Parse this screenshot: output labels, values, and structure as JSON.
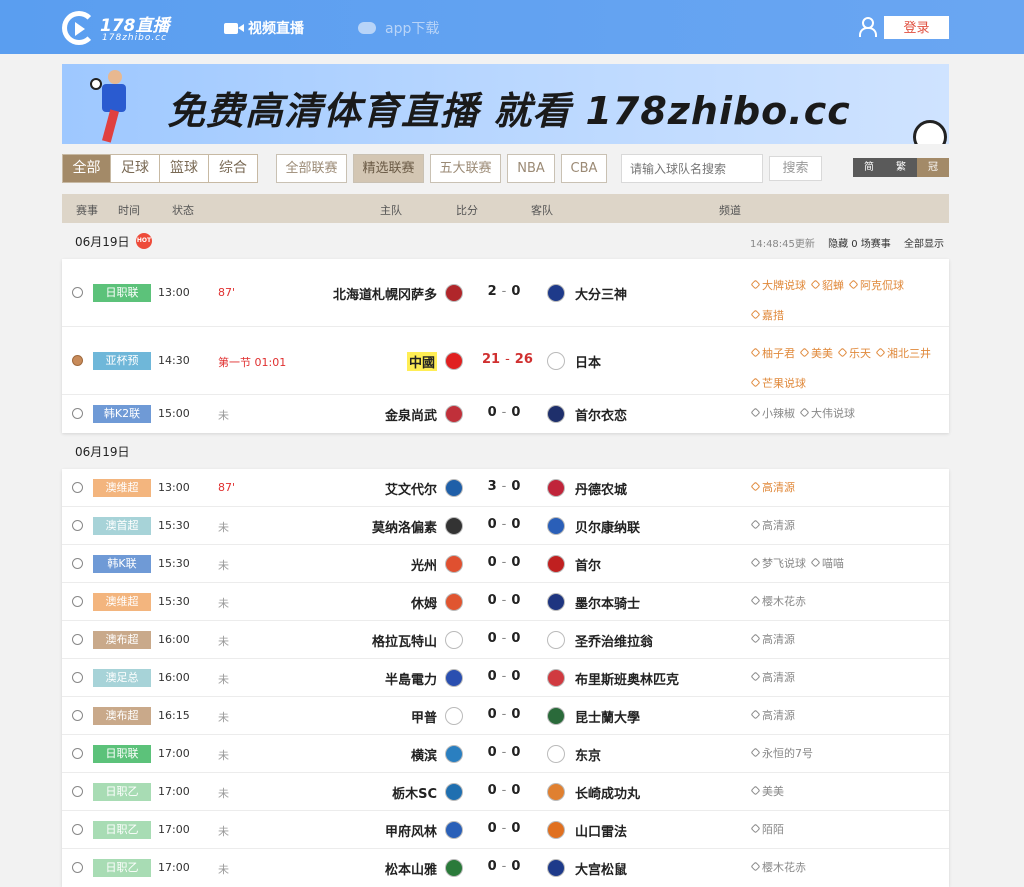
{
  "header": {
    "logo_name": "178直播",
    "logo_url": "178zhibo.cc",
    "nav_video": "视频直播",
    "nav_app": "app下载",
    "login": "登录"
  },
  "banner": {
    "text": "免费高清体育直播 就看 178zhibo.cc"
  },
  "filters": {
    "sports": [
      "全部",
      "足球",
      "篮球",
      "综合"
    ],
    "leagues": [
      "全部联赛",
      "精选联赛",
      "五大联赛",
      "NBA",
      "CBA"
    ],
    "search_placeholder": "请输入球队名搜索",
    "search_button": "搜索",
    "lang": [
      "简",
      "繁",
      "冠"
    ]
  },
  "table_header": [
    "赛事",
    "时间",
    "状态",
    "主队",
    "比分",
    "客队",
    "频道"
  ],
  "colors": {
    "league_green": "#5cc27a",
    "league_blue": "#6f9ad6",
    "league_orange": "#f3b57e",
    "league_cyan": "#a7d3d8",
    "league_khaki": "#c9a98a",
    "league_peach": "#e8b49a",
    "live_red": "#e03030",
    "accent_brown": "#a38a68"
  },
  "section1": {
    "date": "06月19日",
    "hot_label": "HOT",
    "update_time": "14:48:45更新",
    "hidden": "隐藏 0 场赛事",
    "show_all": "全部显示",
    "matches": [
      {
        "sport": "soccer",
        "league": "日职联",
        "lc": "#5cc27a",
        "time": "13:00",
        "status": "87'",
        "live": true,
        "home": "北海道札幌冈萨多",
        "hs": "2",
        "as": "0",
        "away": "大分三神",
        "hic": "#b0262a",
        "aic": "#1e3a8a",
        "chans": [
          [
            "大牌说球",
            true
          ],
          [
            "貂蝉",
            true
          ],
          [
            "阿克侃球",
            true
          ],
          [
            "嘉措",
            true
          ]
        ]
      },
      {
        "sport": "basketball",
        "league": "亚杯预",
        "lc": "#6fb7d9",
        "time": "14:30",
        "status": "第一节 01:01",
        "live": true,
        "home": "中國",
        "hl": true,
        "hs": "21",
        "as": "26",
        "away": "日本",
        "hic": "#e02020",
        "aic": "#ffffff",
        "chans": [
          [
            "柚子君",
            true
          ],
          [
            "美美",
            true
          ],
          [
            "乐天",
            true
          ],
          [
            "湘北三井",
            true
          ],
          [
            "芒果说球",
            true
          ]
        ],
        "scoreLive": true
      },
      {
        "sport": "soccer",
        "league": "韩K2联",
        "lc": "#6f9ad6",
        "time": "15:00",
        "status": "未",
        "home": "金泉尚武",
        "hs": "0",
        "as": "0",
        "away": "首尔衣恋",
        "hic": "#c0303a",
        "aic": "#1e2f6b",
        "chans": [
          [
            "小辣椒",
            false
          ],
          [
            "大伟说球",
            false
          ]
        ]
      }
    ]
  },
  "section2": {
    "date": "06月19日",
    "matches": [
      {
        "league": "澳维超",
        "lc": "#f3b57e",
        "time": "13:00",
        "status": "87'",
        "live": true,
        "home": "艾文代尔",
        "hs": "3",
        "as": "0",
        "away": "丹德农城",
        "hic": "#1f5fa8",
        "aic": "#c0243a",
        "chans": [
          [
            "高清源",
            true
          ]
        ]
      },
      {
        "league": "澳首超",
        "lc": "#a7d3d8",
        "time": "15:30",
        "status": "未",
        "home": "莫纳洛偏素",
        "hs": "0",
        "as": "0",
        "away": "贝尔康纳联",
        "hic": "#333333",
        "aic": "#2a5fb8",
        "chans": [
          [
            "高清源",
            false
          ]
        ]
      },
      {
        "league": "韩K联",
        "lc": "#6f9ad6",
        "time": "15:30",
        "status": "未",
        "home": "光州",
        "hs": "0",
        "as": "0",
        "away": "首尔",
        "hic": "#e05030",
        "aic": "#c02020",
        "chans": [
          [
            "梦飞说球",
            false
          ],
          [
            "喵喵",
            false
          ]
        ]
      },
      {
        "league": "澳维超",
        "lc": "#f3b57e",
        "time": "15:30",
        "status": "未",
        "home": "休姆",
        "hs": "0",
        "as": "0",
        "away": "墨尔本骑士",
        "hic": "#e05530",
        "aic": "#1e3580",
        "chans": [
          [
            "樱木花赤",
            false
          ]
        ]
      },
      {
        "league": "澳布超",
        "lc": "#c9a98a",
        "time": "16:00",
        "status": "未",
        "home": "格拉瓦特山",
        "hs": "0",
        "as": "0",
        "away": "圣乔治维拉翁",
        "hic": "#ffffff",
        "aic": "#ffffff",
        "chans": [
          [
            "高清源",
            false
          ]
        ]
      },
      {
        "league": "澳足总",
        "lc": "#a7d3d8",
        "time": "16:00",
        "status": "未",
        "home": "半島電力",
        "hs": "0",
        "as": "0",
        "away": "布里斯班奥林匹克",
        "hic": "#2a4fb0",
        "aic": "#d03a40",
        "chans": [
          [
            "高清源",
            false
          ]
        ]
      },
      {
        "league": "澳布超",
        "lc": "#c9a98a",
        "time": "16:15",
        "status": "未",
        "home": "甲普",
        "hs": "0",
        "as": "0",
        "away": "昆士蘭大學",
        "hic": "#ffffff",
        "aic": "#2a6a3a",
        "chans": [
          [
            "高清源",
            false
          ]
        ]
      },
      {
        "league": "日职联",
        "lc": "#5cc27a",
        "time": "17:00",
        "status": "未",
        "home": "横滨",
        "hs": "0",
        "as": "0",
        "away": "东京",
        "hic": "#2a7fc0",
        "aic": "#ffffff",
        "chans": [
          [
            "永恒的7号",
            false
          ]
        ]
      },
      {
        "league": "日职乙",
        "lc": "#a8dcb4",
        "time": "17:00",
        "status": "未",
        "home": "栃木SC",
        "hs": "0",
        "as": "0",
        "away": "长崎成功丸",
        "hic": "#1f6fb0",
        "aic": "#e08030",
        "chans": [
          [
            "美美",
            false
          ]
        ]
      },
      {
        "league": "日职乙",
        "lc": "#a8dcb4",
        "time": "17:00",
        "status": "未",
        "home": "甲府风林",
        "hs": "0",
        "as": "0",
        "away": "山口雷法",
        "hic": "#2a60b8",
        "aic": "#e07020",
        "chans": [
          [
            "陌陌",
            false
          ]
        ]
      },
      {
        "league": "日职乙",
        "lc": "#a8dcb4",
        "time": "17:00",
        "status": "未",
        "home": "松本山雅",
        "hs": "0",
        "as": "0",
        "away": "大宫松鼠",
        "hic": "#2a7a3a",
        "aic": "#1e3a8a",
        "chans": [
          [
            "樱木花赤",
            false
          ]
        ]
      }
    ]
  }
}
